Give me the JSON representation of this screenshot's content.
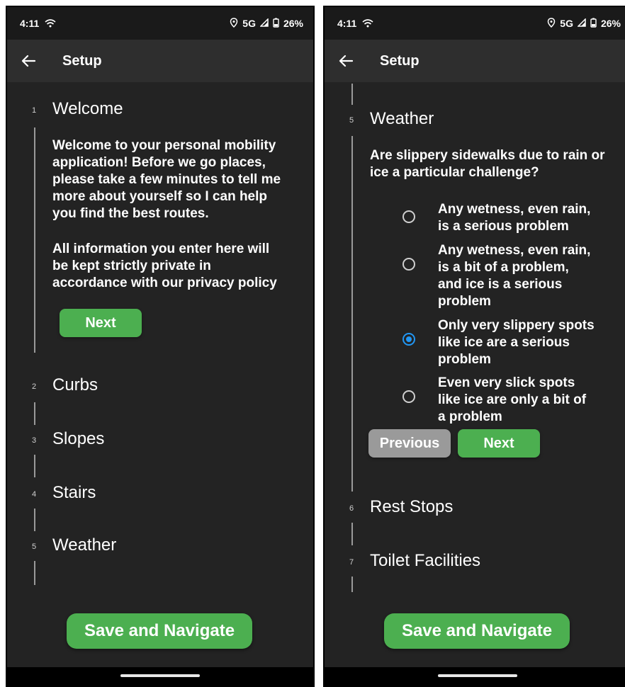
{
  "status": {
    "time": "4:11",
    "network": "5G",
    "battery": "26%"
  },
  "appbar": {
    "title": "Setup"
  },
  "left": {
    "steps": [
      {
        "num": "1",
        "label": "Welcome"
      },
      {
        "num": "2",
        "label": "Curbs"
      },
      {
        "num": "3",
        "label": "Slopes"
      },
      {
        "num": "4",
        "label": "Stairs"
      },
      {
        "num": "5",
        "label": "Weather"
      }
    ],
    "welcome_lines_1": [
      "Welcome to your personal mobility",
      "application! Before we go places,",
      "please take a few minutes to tell me",
      "more about yourself so I can help",
      "you find the best routes."
    ],
    "welcome_lines_2": [
      "All information you enter here will",
      "be kept strictly private in",
      "accordance with our privacy policy"
    ],
    "next_label": "Next"
  },
  "right": {
    "weather_step": {
      "num": "5",
      "label": "Weather"
    },
    "question_lines": [
      "Are slippery sidewalks due to rain or",
      "ice a particular challenge?"
    ],
    "options": [
      {
        "lines": [
          "Any wetness, even rain,",
          "is a serious problem"
        ],
        "selected": false
      },
      {
        "lines": [
          "Any wetness, even rain,",
          "is a bit of a problem,",
          "and ice is a serious",
          "problem"
        ],
        "selected": false
      },
      {
        "lines": [
          "Only very slippery spots",
          "like ice are a serious",
          "problem"
        ],
        "selected": true
      },
      {
        "lines": [
          "Even very slick spots",
          "like ice are only a bit of",
          "a problem"
        ],
        "selected": false
      }
    ],
    "previous_label": "Previous",
    "next_label": "Next",
    "later_steps": [
      {
        "num": "6",
        "label": "Rest Stops"
      },
      {
        "num": "7",
        "label": "Toilet Facilities"
      }
    ]
  },
  "save_label": "Save and Navigate",
  "colors": {
    "accent_green": "#4caf50",
    "radio_selected": "#2196f3",
    "background": "#232323"
  }
}
